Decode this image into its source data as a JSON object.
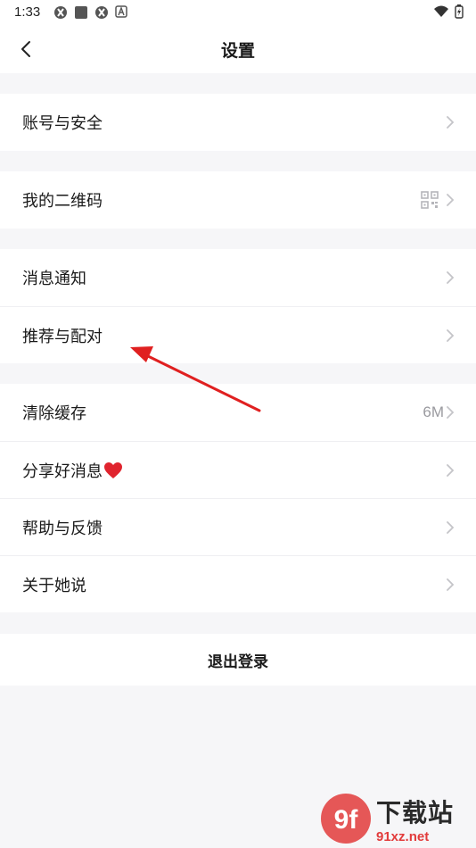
{
  "status_bar": {
    "time": "1:33"
  },
  "header": {
    "title": "设置"
  },
  "groups": {
    "account": {
      "label": "账号与安全"
    },
    "qrcode": {
      "label": "我的二维码"
    },
    "notifications": {
      "label": "消息通知"
    },
    "recommend": {
      "label": "推荐与配对"
    },
    "cache": {
      "label": "清除缓存",
      "value": "6M"
    },
    "share": {
      "label": "分享好消息"
    },
    "help": {
      "label": "帮助与反馈"
    },
    "about": {
      "label": "关于她说"
    }
  },
  "logout": {
    "label": "退出登录"
  },
  "watermark": {
    "main": "下载站",
    "sub": "91xz.net",
    "logo": "9f"
  },
  "colors": {
    "background": "#f6f6f8",
    "row_bg": "#ffffff",
    "chevron": "#c4c4c8",
    "annotation_arrow": "#e02020",
    "heart": "#e0242e"
  }
}
